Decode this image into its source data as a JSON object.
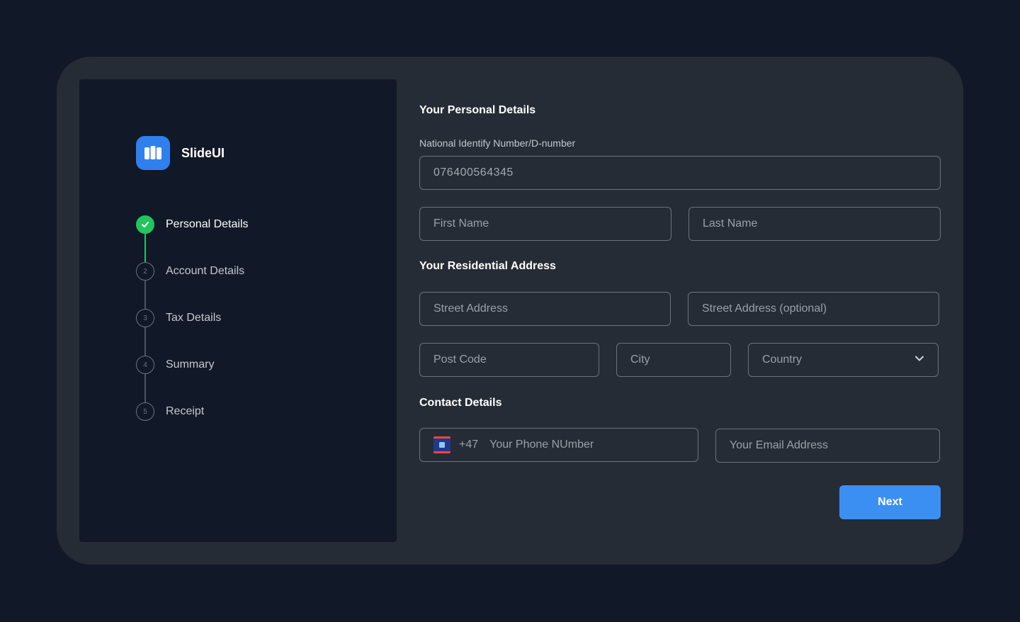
{
  "brand": {
    "name": "SlideUI",
    "logo_icon": "book-icon",
    "accent": "#2f80ed"
  },
  "steps": [
    {
      "number": "",
      "label": "Personal Details",
      "status": "complete"
    },
    {
      "number": "2",
      "label": "Account Details",
      "status": "pending"
    },
    {
      "number": "3",
      "label": "Tax Details",
      "status": "pending"
    },
    {
      "number": "4",
      "label": "Summary",
      "status": "pending"
    },
    {
      "number": "5",
      "label": "Receipt",
      "status": "pending"
    }
  ],
  "personal": {
    "title": "Your Personal Details",
    "national_id_label": "National Identify Number/D-number",
    "national_id_value": "076400564345",
    "first_name_placeholder": "First Name",
    "last_name_placeholder": "Last Name"
  },
  "address": {
    "title": "Your Residential Address",
    "street_placeholder": "Street Address",
    "street2_placeholder": "Street Address (optional)",
    "postcode_placeholder": "Post Code",
    "city_placeholder": "City",
    "country_placeholder": "Country"
  },
  "contact": {
    "title": "Contact Details",
    "dial_code": "+47",
    "phone_placeholder": "Your Phone NUmber",
    "email_placeholder": "Your Email Address"
  },
  "actions": {
    "next_label": "Next"
  },
  "colors": {
    "complete": "#22c55e",
    "primary_button": "#3b8ff3"
  }
}
